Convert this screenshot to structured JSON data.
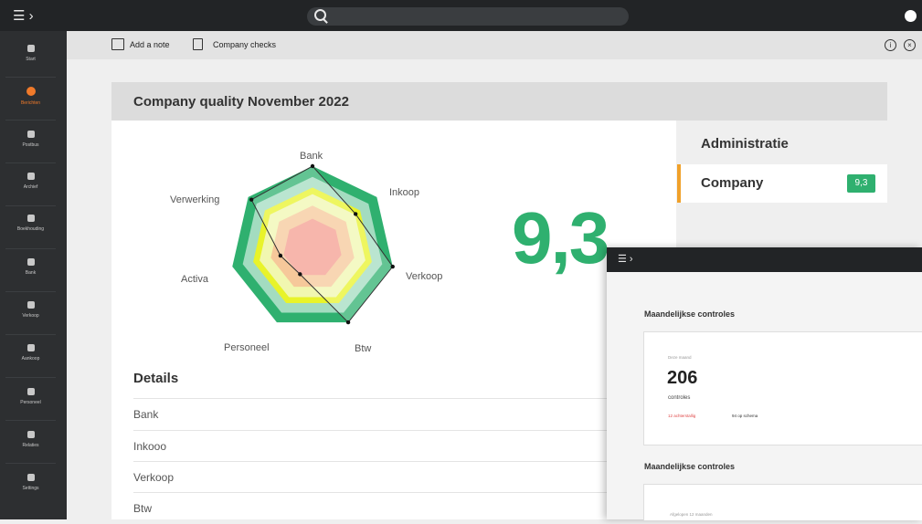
{
  "topbar": {
    "menu_icon": "hamburger-icon",
    "search_icon": "search-icon",
    "search_placeholder": ""
  },
  "sidebar": {
    "items": [
      {
        "label": "Start",
        "icon": "home-icon",
        "active": false
      },
      {
        "label": "Berichten",
        "icon": "message-icon",
        "active": true
      },
      {
        "label": "Postbus",
        "icon": "inbox-icon",
        "active": false
      },
      {
        "label": "Archief",
        "icon": "archive-icon",
        "active": false
      },
      {
        "label": "Boekhouding",
        "icon": "chart-icon",
        "active": false
      },
      {
        "label": "Bank",
        "icon": "bank-icon",
        "active": false
      },
      {
        "label": "Verkoop",
        "icon": "sales-icon",
        "active": false
      },
      {
        "label": "Aankoop",
        "icon": "truck-icon",
        "active": false
      },
      {
        "label": "Personeel",
        "icon": "people-icon",
        "active": false
      },
      {
        "label": "Relaties",
        "icon": "contacts-icon",
        "active": false
      },
      {
        "label": "Settings",
        "icon": "gear-icon",
        "active": false
      }
    ]
  },
  "toolbar": {
    "add_note": "Add a note",
    "company_checks": "Company checks"
  },
  "card": {
    "title": "Company quality November 2022",
    "score": "9,3"
  },
  "chart_data": {
    "type": "radar",
    "axes": [
      "Bank",
      "Inkoop",
      "Verkoop",
      "Btw",
      "Personeel",
      "Activa",
      "Verwerking"
    ],
    "series": [
      {
        "values": [
          100,
          67,
          100,
          100,
          35,
          40,
          95
        ]
      }
    ],
    "colors": {
      "band_outer": "#2fb06f",
      "band_green_light": "#a3dcc0",
      "band_yellow": "#e8f32a",
      "band_pale": "#f1f7b0",
      "band_orange": "#f6c89a",
      "band_core": "#f59e90",
      "highlight_orange": "#f08a1e"
    }
  },
  "details": {
    "title": "Details",
    "rows": [
      "Bank",
      "Inkooo",
      "Verkoop",
      "Btw"
    ]
  },
  "admin": {
    "title": "Administratie",
    "company_label": "Company",
    "company_score": "9,3",
    "accent": "#f0a12a"
  },
  "overlay": {
    "section1": "Maandelijkse controles",
    "small_label": "Deze maand",
    "number": "206",
    "controls_label": "controles",
    "red_text": "12 achterstallig",
    "schema_text": "94 op schema",
    "section2": "Maandelijkse controles",
    "small_label2": "Afgelopen 12 maanden"
  }
}
